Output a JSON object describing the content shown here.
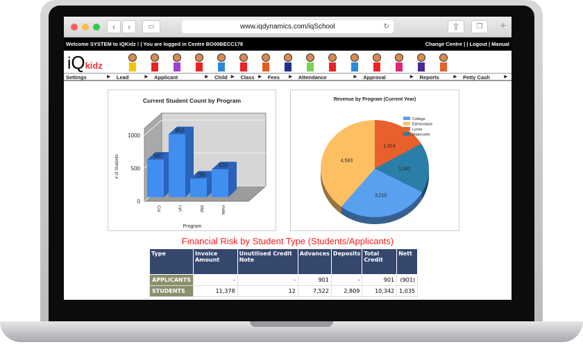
{
  "browser": {
    "url": "www.iqdynamics.com/iqSchool",
    "back": "‹",
    "forward": "›",
    "plus": "+"
  },
  "topbar": {
    "welcome": "Welcome SYSTEM to iQKidz ! | You are logged in Centre BO00BECC178",
    "links": "Change Centre | | Logout  | Manual"
  },
  "logo": {
    "i": "i",
    "q": "Q",
    "kidz": "kidz"
  },
  "menu": [
    "Settings",
    "Lead",
    "Applicant",
    "Child",
    "Class",
    "Fees",
    "Attendance",
    "Approval",
    "Reports",
    "Petty Cash"
  ],
  "colors": {
    "bar": "#3f8ef0",
    "bar_dark": "#2a62b8",
    "header": "#36476e",
    "type_cell": "#8a8f6c",
    "risk_title": "#ff1a1a"
  },
  "chart_data": [
    {
      "type": "bar",
      "title": "Current Student Count by Program",
      "xlabel": "Program",
      "ylabel": "# of Students",
      "categories": [
        "Col",
        "Lyc",
        "Mat",
        "mate"
      ],
      "values": [
        567,
        952,
        280,
        420
      ],
      "ylim": [
        0,
        1000
      ],
      "yticks": [
        0,
        500,
        1000
      ],
      "style": "3d",
      "grid": true
    },
    {
      "type": "pie",
      "title": "Revenue by Program (Current Year)",
      "legend": [
        "Collège",
        "Élémentaire",
        "Lycée",
        "Maternelle"
      ],
      "legend_position": "top-right",
      "slices": [
        {
          "label": "Lycée",
          "value": 1914,
          "display": "1,914",
          "color": "#e8602c"
        },
        {
          "label": "Maternelle",
          "value": 1942,
          "display": "1,942",
          "color": "#2b7ea8"
        },
        {
          "label": "Collège",
          "value": 3210,
          "display": "3,210",
          "color": "#5aa0f0"
        },
        {
          "label": "Élémentaire",
          "value": 4593,
          "display": "4,593",
          "color": "#fdbf62"
        }
      ],
      "style": "3d"
    }
  ],
  "risk": {
    "title": "Financial Risk by Student Type (Students/Applicants)",
    "headers": [
      "Type",
      "Invoice Amount",
      "Unutilised Credit Note",
      "Advances",
      "Deposits",
      "Total Credit",
      "Nett"
    ],
    "rows": [
      [
        "APPLICANTS",
        "-",
        "-",
        "901",
        "-",
        "901",
        "(901)"
      ],
      [
        "STUDENTS",
        "11,378",
        "12",
        "7,522",
        "2,809",
        "10,342",
        "1,035"
      ]
    ]
  }
}
